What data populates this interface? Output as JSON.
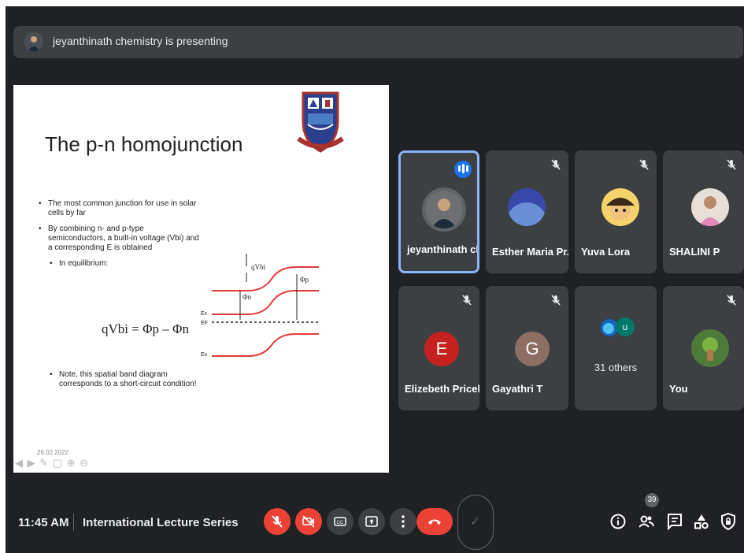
{
  "banner": {
    "text": "jeyanthinath chemistry is presenting"
  },
  "slide": {
    "title": "The p-n homojunction",
    "bullets": [
      "The most common junction for use in solar cells by far",
      "By combining n- and p-type semiconductors, a built-in voltage (Vbi) and a corresponding E is obtained"
    ],
    "sub_bullet": "In equilibrium:",
    "equation": "qVbi = Φp – Φn",
    "note": "Note, this spatial band diagram corresponds to a short-circuit condition!",
    "diagram_labels": {
      "qvbi": "qVbi",
      "phi_n": "Φn",
      "phi_p": "Φp",
      "ec": "Ec",
      "ef": "EF",
      "ev": "Ev"
    },
    "date": "26.02.2022"
  },
  "participants": [
    {
      "name": "jeyanthinath ch...",
      "speaking": true,
      "icon": "speaking-icon"
    },
    {
      "name": "Esther Maria Pr...",
      "muted": true
    },
    {
      "name": "Yuva Lora",
      "muted": true
    },
    {
      "name": "SHALINI P",
      "muted": true
    },
    {
      "name": "Elizebeth Pricela",
      "muted": true,
      "initial": "E",
      "color": "#c5221f"
    },
    {
      "name": "Gayathri T",
      "muted": true,
      "initial": "G",
      "color": "#8d6e63"
    },
    {
      "name": "31 others",
      "initial": "u",
      "color": "#00796b"
    },
    {
      "name": "You",
      "muted": true
    }
  ],
  "bottom": {
    "time": "11:45 AM",
    "meeting_title": "International Lecture Series",
    "people_count": "39"
  },
  "colors": {
    "accent": "#8ab4f8",
    "danger": "#ea4335",
    "tile": "#3c4043",
    "bg": "#202124"
  }
}
